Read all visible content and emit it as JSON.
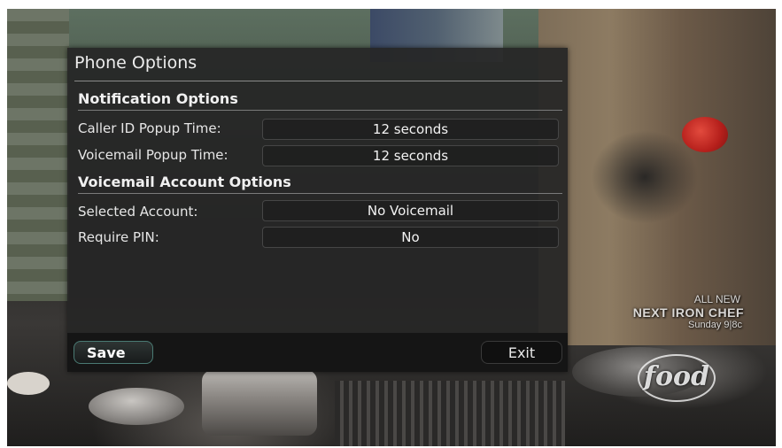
{
  "dialog": {
    "title": "Phone Options",
    "sections": [
      {
        "heading": "Notification Options",
        "rows": [
          {
            "label": "Caller ID Popup Time:",
            "value": "12 seconds"
          },
          {
            "label": "Voicemail Popup Time:",
            "value": "12 seconds"
          }
        ]
      },
      {
        "heading": "Voicemail Account Options",
        "rows": [
          {
            "label": "Selected Account:",
            "value": "No Voicemail"
          },
          {
            "label": "Require PIN:",
            "value": "No"
          }
        ]
      }
    ],
    "save_label": "Save",
    "exit_label": "Exit"
  },
  "background": {
    "promo_line1": "ALL NEW",
    "promo_line2": "NEXT IRON CHEF",
    "promo_line3": "Sunday 9|8c",
    "channel_logo": "food"
  },
  "colors": {
    "dialog_bg": "#262626",
    "save_border_accent": "#4a7a73"
  }
}
